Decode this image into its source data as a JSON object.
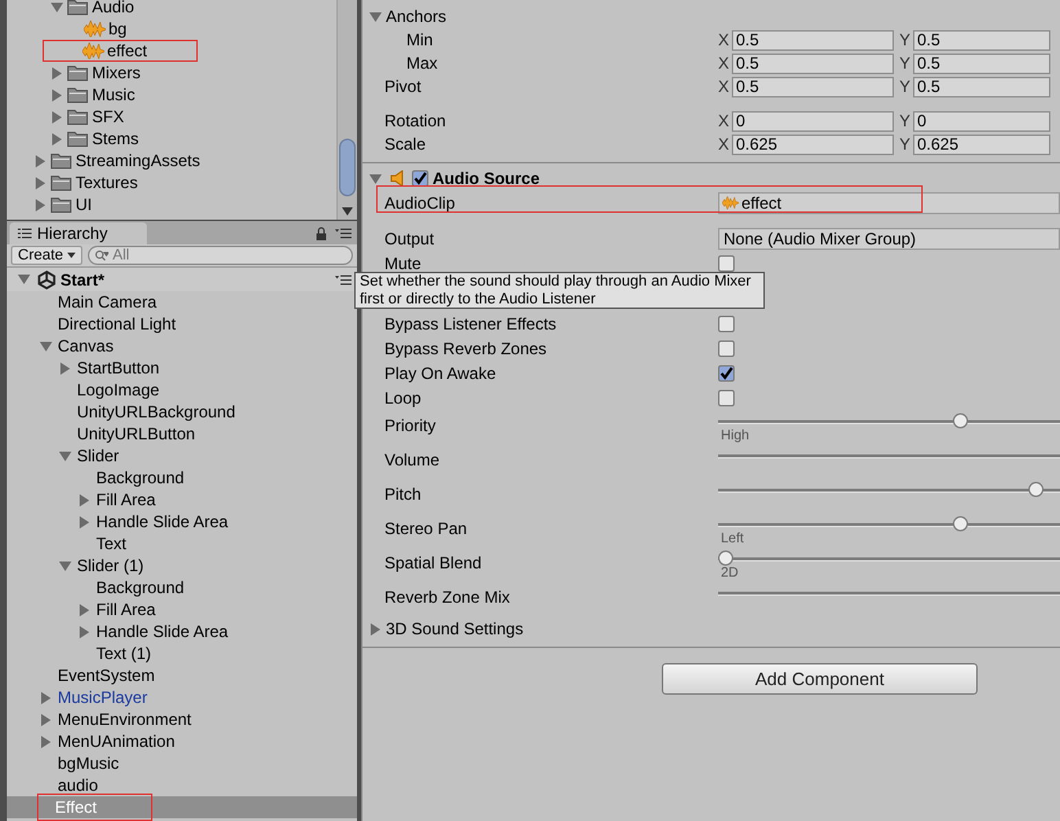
{
  "project": {
    "open_folder": [
      {
        "label": "Audio",
        "kind": "folder",
        "expanded": true,
        "children": [
          {
            "label": "bg",
            "kind": "audio",
            "annotated": false
          },
          {
            "label": "effect",
            "kind": "audio",
            "annotated": true
          }
        ]
      },
      {
        "label": "Mixers",
        "kind": "folder",
        "expanded": false
      },
      {
        "label": "Music",
        "kind": "folder",
        "expanded": false
      },
      {
        "label": "SFX",
        "kind": "folder",
        "expanded": false
      },
      {
        "label": "Stems",
        "kind": "folder",
        "expanded": false
      }
    ],
    "tree": [
      {
        "label": "StreamingAssets",
        "kind": "folder",
        "expanded": false
      },
      {
        "label": "Textures",
        "kind": "folder",
        "expanded": false
      },
      {
        "label": "UI",
        "kind": "folder",
        "expanded": false
      }
    ]
  },
  "hierarchy": {
    "tab": "Hierarchy",
    "create": "Create",
    "search_placeholder": "All",
    "scene": "Start*",
    "items": [
      {
        "label": "Main Camera",
        "kind": "object",
        "selected": false,
        "annotated": false
      },
      {
        "label": "Directional Light",
        "kind": "object",
        "selected": false,
        "annotated": false
      },
      {
        "label": "Canvas",
        "kind": "object",
        "expanded": true,
        "selected": false,
        "annotated": false,
        "children": [
          {
            "label": "StartButton",
            "kind": "object",
            "expanded": false,
            "selected": false,
            "annotated": false
          },
          {
            "label": "LogoImage",
            "kind": "object",
            "selected": false,
            "annotated": false
          },
          {
            "label": "UnityURLBackground",
            "kind": "object",
            "selected": false,
            "annotated": false
          },
          {
            "label": "UnityURLButton",
            "kind": "object",
            "selected": false,
            "annotated": false
          },
          {
            "label": "Slider",
            "kind": "object",
            "expanded": true,
            "selected": false,
            "annotated": false,
            "children": [
              {
                "label": "Background",
                "kind": "object",
                "selected": false,
                "annotated": false
              },
              {
                "label": "Fill Area",
                "kind": "object",
                "expanded": false,
                "selected": false,
                "annotated": false
              },
              {
                "label": "Handle Slide Area",
                "kind": "object",
                "expanded": false,
                "selected": false,
                "annotated": false
              },
              {
                "label": "Text",
                "kind": "object",
                "selected": false,
                "annotated": false
              }
            ]
          },
          {
            "label": "Slider (1)",
            "kind": "object",
            "expanded": true,
            "selected": false,
            "annotated": false,
            "children": [
              {
                "label": "Background",
                "kind": "object",
                "selected": false,
                "annotated": false
              },
              {
                "label": "Fill Area",
                "kind": "object",
                "expanded": false,
                "selected": false,
                "annotated": false
              },
              {
                "label": "Handle Slide Area",
                "kind": "object",
                "expanded": false,
                "selected": false,
                "annotated": false
              },
              {
                "label": "Text (1)",
                "kind": "object",
                "selected": false,
                "annotated": false
              }
            ]
          }
        ]
      },
      {
        "label": "EventSystem",
        "kind": "object",
        "selected": false,
        "annotated": false
      },
      {
        "label": "MusicPlayer",
        "kind": "prefab",
        "expanded": false,
        "selected": false,
        "annotated": false
      },
      {
        "label": "MenuEnvironment",
        "kind": "object",
        "expanded": false,
        "selected": false,
        "annotated": false
      },
      {
        "label": "MenUAnimation",
        "kind": "object",
        "expanded": false,
        "selected": false,
        "annotated": false
      },
      {
        "label": "bgMusic",
        "kind": "object",
        "selected": false,
        "annotated": false
      },
      {
        "label": "audio",
        "kind": "object",
        "selected": false,
        "annotated": false
      },
      {
        "label": "Effect",
        "kind": "object",
        "selected": true,
        "annotated": true
      }
    ]
  },
  "transform": {
    "groups": [
      [
        {
          "label": "Anchors",
          "expanded": true,
          "children": [
            {
              "label": "Min",
              "fields": [
                {
                  "axis": "X",
                  "value": "0.5"
                },
                {
                  "axis": "Y",
                  "value": "0.5"
                }
              ]
            },
            {
              "label": "Max",
              "fields": [
                {
                  "axis": "X",
                  "value": "0.5"
                },
                {
                  "axis": "Y",
                  "value": "0.5"
                }
              ]
            }
          ]
        },
        {
          "label": "Pivot",
          "fields": [
            {
              "axis": "X",
              "value": "0.5"
            },
            {
              "axis": "Y",
              "value": "0.5"
            }
          ]
        }
      ],
      [
        {
          "label": "Rotation",
          "fields": [
            {
              "axis": "X",
              "value": "0"
            },
            {
              "axis": "Y",
              "value": "0"
            }
          ]
        },
        {
          "label": "Scale",
          "fields": [
            {
              "axis": "X",
              "value": "0.625"
            },
            {
              "axis": "Y",
              "value": "0.625"
            }
          ]
        }
      ]
    ]
  },
  "audio_source": {
    "title": "Audio Source",
    "enabled": true,
    "expanded": true,
    "properties": [
      {
        "kind": "object",
        "label": "AudioClip",
        "value": "effect",
        "annotated": true
      },
      {
        "kind": "dropdown",
        "label": "Output",
        "value": "None (Audio Mixer Group)"
      },
      {
        "kind": "checkbox",
        "label": "Mute",
        "checked": false
      },
      {
        "kind": "hidden"
      },
      {
        "kind": "checkbox",
        "label": "Bypass Listener Effects",
        "checked": false
      },
      {
        "kind": "checkbox",
        "label": "Bypass Reverb Zones",
        "checked": false
      },
      {
        "kind": "checkbox",
        "label": "Play On Awake",
        "checked": true
      },
      {
        "kind": "checkbox",
        "label": "Loop",
        "checked": false
      },
      {
        "kind": "slider",
        "label": "Priority",
        "level": 0.72,
        "caption": "High"
      },
      {
        "kind": "slider",
        "label": "Volume"
      },
      {
        "kind": "slider",
        "label": "Pitch",
        "level": 0.95
      },
      {
        "kind": "slider",
        "label": "Stereo Pan",
        "level": 0.72,
        "caption": "Left"
      },
      {
        "kind": "slider",
        "label": "Spatial Blend",
        "level": 0.0,
        "caption": "2D"
      },
      {
        "kind": "slider",
        "label": "Reverb Zone Mix"
      }
    ],
    "foldout": {
      "label": "3D Sound Settings",
      "expanded": false
    }
  },
  "tooltip": "Set whether the sound should play through an Audio Mixer first or directly to the Audio Listener",
  "add_component": "Add Component"
}
